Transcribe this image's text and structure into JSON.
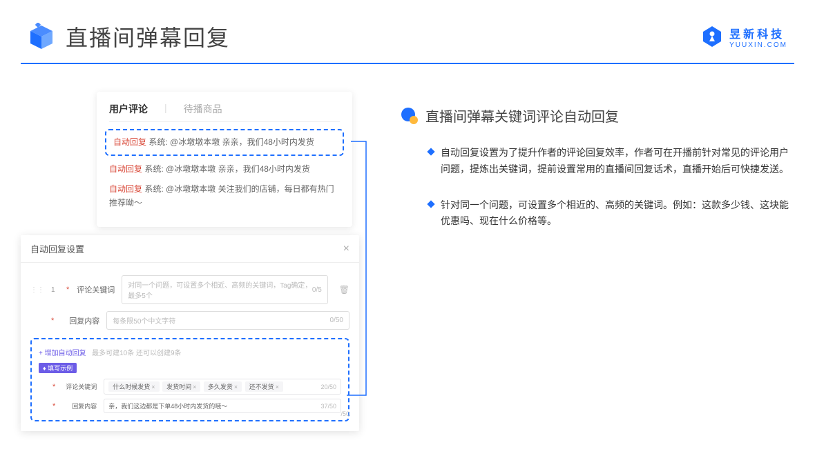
{
  "header": {
    "title": "直播间弹幕回复",
    "brand_name": "昱新科技",
    "brand_sub": "YUUXIN.COM"
  },
  "comment_panel": {
    "tab_active": "用户评论",
    "tab_inactive": "待播商品",
    "auto_tag": "自动回复",
    "system_label": "系统:",
    "c1": "@冰墩墩本墩 亲亲，我们48小时内发货",
    "c2": "@冰墩墩本墩 亲亲，我们48小时内发货",
    "c3": "@冰墩墩本墩 关注我们的店铺，每日都有热门推荐呦～"
  },
  "settings": {
    "title": "自动回复设置",
    "row_num": "1",
    "label_keyword": "评论关键词",
    "placeholder_keyword": "对同一个问题，可设置多个相近、高频的关键词，Tag确定，最多5个",
    "count_keyword": "0/5",
    "label_content": "回复内容",
    "placeholder_content": "每条限50个中文字符",
    "count_content": "0/50",
    "add_link": "+ 增加自动回复",
    "add_hint": "最多可建10条 还可以创建9条",
    "badge": "♦ 填写示例",
    "ex_label_keyword": "评论关键词",
    "chips": [
      "什么时候发货",
      "发货时间",
      "多久发货",
      "还不发货"
    ],
    "ex_count_keyword": "20/50",
    "ex_label_content": "回复内容",
    "ex_content": "亲，我们这边都是下单48小时内发货的哦～",
    "ex_count_content": "37/50",
    "hidden_count": "/50"
  },
  "right": {
    "section_title": "直播间弹幕关键词评论自动回复",
    "b1": "自动回复设置为了提升作者的评论回复效率，作者可在开播前针对常见的评论用户问题，提炼出关键词，提前设置常用的直播间回复话术，直播开始后可快捷发送。",
    "b2": "针对同一个问题，可设置多个相近的、高频的关键词。例如：这款多少钱、这块能优惠吗、现在什么价格等。"
  }
}
